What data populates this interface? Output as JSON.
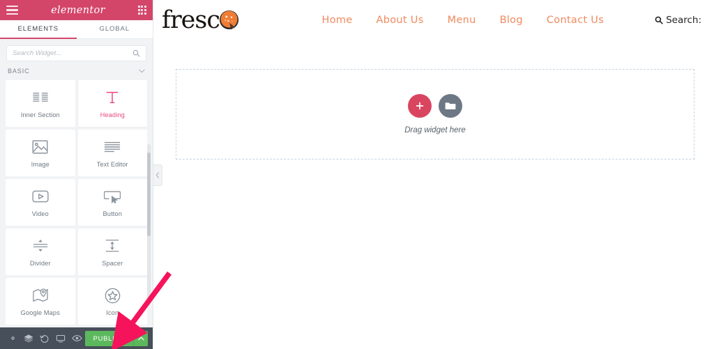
{
  "editor": {
    "brand": "elementor",
    "menu_icon": "hamburger-icon",
    "apps_icon": "grid-icon",
    "tabs": [
      {
        "label": "ELEMENTS",
        "active": true
      },
      {
        "label": "GLOBAL",
        "active": false
      }
    ],
    "search": {
      "placeholder": "Search Widget...",
      "value": "",
      "icon": "search-icon"
    },
    "category": {
      "title": "BASIC",
      "chevron": "chevron-down-icon",
      "expanded": true
    },
    "widgets": [
      {
        "label": "Inner Section",
        "icon": "inner-section-icon",
        "active": false
      },
      {
        "label": "Heading",
        "icon": "heading-icon",
        "active": true
      },
      {
        "label": "Image",
        "icon": "image-icon",
        "active": false
      },
      {
        "label": "Text Editor",
        "icon": "text-editor-icon",
        "active": false
      },
      {
        "label": "Video",
        "icon": "video-icon",
        "active": false
      },
      {
        "label": "Button",
        "icon": "button-icon",
        "active": false
      },
      {
        "label": "Divider",
        "icon": "divider-icon",
        "active": false
      },
      {
        "label": "Spacer",
        "icon": "spacer-icon",
        "active": false
      },
      {
        "label": "Google Maps",
        "icon": "google-maps-icon",
        "active": false
      },
      {
        "label": "Icon",
        "icon": "star-icon",
        "active": false
      }
    ],
    "footer": {
      "icons": [
        {
          "name": "settings-gear-icon",
          "title": "Settings"
        },
        {
          "name": "navigator-layers-icon",
          "title": "Navigator"
        },
        {
          "name": "history-revisions-icon",
          "title": "History"
        },
        {
          "name": "responsive-monitor-icon",
          "title": "Responsive Mode"
        },
        {
          "name": "preview-eye-icon",
          "title": "Preview Changes"
        }
      ],
      "publish_label": "PUBLISH",
      "publish_caret": "chevron-up-icon",
      "publish_color": "#5cb85c"
    },
    "collapse_handle": "chevron-left-icon",
    "accent_color": "#d4456a"
  },
  "site": {
    "logo_text": "fresc",
    "logo_mark": "pizza-slice-icon",
    "nav": [
      {
        "label": "Home"
      },
      {
        "label": "About Us"
      },
      {
        "label": "Menu"
      },
      {
        "label": "Blog"
      },
      {
        "label": "Contact Us"
      }
    ],
    "search_label": "Search:",
    "search_icon": "search-icon",
    "nav_color": "#f08a5f"
  },
  "canvas": {
    "dropzone": {
      "text": "Drag widget here",
      "add_icon": "plus-icon",
      "template_icon": "folder-icon",
      "add_color": "#d9455f",
      "template_color": "#6d7884"
    }
  },
  "annotation": {
    "arrow": "arrow-pointing-to-publish",
    "color": "#f5145c"
  }
}
